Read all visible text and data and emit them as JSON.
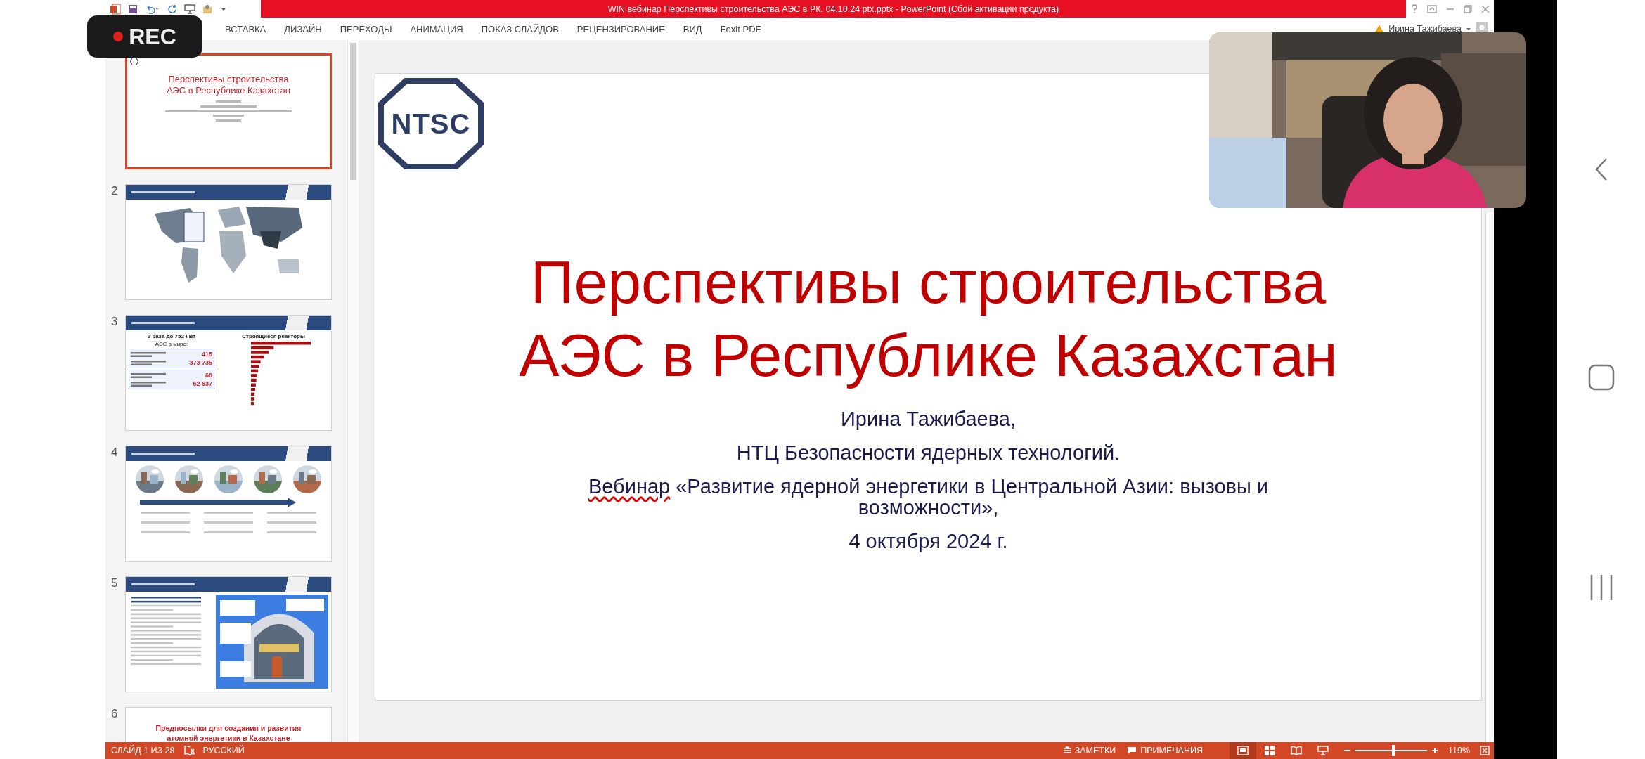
{
  "title_bar": {
    "title": "WIN вебинар Перспективы строительства АЭС в РК. 04.10.24 ptx.pptx  -  PowerPoint (Сбой активации продукта)"
  },
  "recording": {
    "label": "REC"
  },
  "ribbon": {
    "tabs": [
      "ВСТАВКА",
      "ДИЗАЙН",
      "ПЕРЕХОДЫ",
      "АНИМАЦИЯ",
      "ПОКАЗ СЛАЙДОВ",
      "РЕЦЕНЗИРОВАНИЕ",
      "ВИД",
      "Foxit PDF"
    ],
    "user": "Ирина Тажибаева"
  },
  "thumbnails": [
    {
      "selected": true,
      "kind": "title",
      "title_lines": [
        "Перспективы строительства",
        "АЭС в Республике Казахстан"
      ]
    },
    {
      "number": "2",
      "selected": false,
      "kind": "map"
    },
    {
      "number": "3",
      "selected": false,
      "kind": "stats",
      "headline": "2 раза до 752 ГВт",
      "subhead": "АЭС в мире:",
      "stat_values": [
        "415",
        "373 735",
        "60",
        "62 637"
      ],
      "chart_title": "Строящиеся реакторы"
    },
    {
      "number": "4",
      "selected": false,
      "kind": "timeline"
    },
    {
      "number": "5",
      "selected": false,
      "kind": "safety"
    },
    {
      "number": "6",
      "selected": false,
      "kind": "text",
      "title_lines": [
        "Предпосылки для создания и развития",
        "атомной энергетики в Казахстане"
      ]
    }
  ],
  "slide": {
    "logo_text": "NTSC",
    "title_lines": [
      "Перспективы строительства",
      "АЭС в Республике Казахстан"
    ],
    "author": "Ирина Тажибаева,",
    "organization": "НТЦ Безопасности ядерных технологий.",
    "webinar": {
      "text": "Вебинар «Развитие  ядерной энергетики в Центральной Азии: вызовы и возможности»,",
      "first_word_flagged": true
    },
    "date": "4 октября 2024 г."
  },
  "status_bar": {
    "slide_counter": "СЛАЙД 1 ИЗ 28",
    "language": "РУССКИЙ",
    "notes": "ЗАМЕТКИ",
    "comments": "ПРИМЕЧАНИЯ",
    "views": [
      {
        "kind": "normal",
        "selected": true
      },
      {
        "kind": "sorter",
        "selected": false
      },
      {
        "kind": "reading",
        "selected": false
      },
      {
        "kind": "slideshow",
        "selected": false
      }
    ],
    "zoom_slider": {
      "level": 0.53
    },
    "zoom": "119%"
  }
}
